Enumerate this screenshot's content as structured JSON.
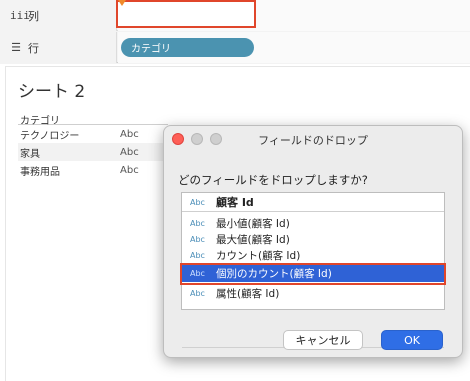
{
  "shelves": {
    "columns_icon": "iii",
    "columns_label": "列",
    "rows_icon": "☰",
    "rows_label": "行",
    "rows_pill": "カテゴリ"
  },
  "sheet": {
    "title": "シート 2",
    "header": "カテゴリ",
    "rows": [
      {
        "label": "テクノロジー",
        "value": "Abc"
      },
      {
        "label": "家具",
        "value": "Abc"
      },
      {
        "label": "事務用品",
        "value": "Abc"
      }
    ]
  },
  "dialog": {
    "title": "フィールドのドロップ",
    "prompt": "どのフィールドをドロップしますか?",
    "header_item": {
      "type": "Abc",
      "label": "顧客 Id"
    },
    "items": [
      {
        "type": "Abc",
        "label": "最小値(顧客 Id)"
      },
      {
        "type": "Abc",
        "label": "最大値(顧客 Id)"
      },
      {
        "type": "Abc",
        "label": "カウント(顧客 Id)"
      },
      {
        "type": "Abc",
        "label": "個別のカウント(顧客 Id)",
        "selected": true
      },
      {
        "type": "Abc",
        "label": "属性(顧客 Id)"
      }
    ],
    "cancel_label": "キャンセル",
    "ok_label": "OK"
  },
  "colors": {
    "pill": "#4b93b0",
    "selection": "#2f62d6",
    "highlight": "#e0462b",
    "ok_button": "#2f6ee6"
  }
}
